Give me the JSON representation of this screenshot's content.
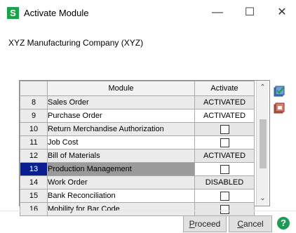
{
  "window": {
    "icon_letter": "S",
    "title": "Activate Module",
    "minimize_glyph": "—",
    "maximize_glyph": "☐",
    "close_glyph": "✕"
  },
  "company": "XYZ Manufacturing Company (XYZ)",
  "grid": {
    "columns": [
      "",
      "Module",
      "Activate"
    ],
    "rows": [
      {
        "num": "8",
        "module": "Sales Order",
        "activate": "ACTIVATED",
        "checkbox": false
      },
      {
        "num": "9",
        "module": "Purchase Order",
        "activate": "ACTIVATED",
        "checkbox": false
      },
      {
        "num": "10",
        "module": "Return Merchandise Authorization",
        "activate": "",
        "checkbox": true
      },
      {
        "num": "11",
        "module": "Job Cost",
        "activate": "",
        "checkbox": true
      },
      {
        "num": "12",
        "module": "Bill of Materials",
        "activate": "ACTIVATED",
        "checkbox": false
      },
      {
        "num": "13",
        "module": "Production Management",
        "activate": "",
        "checkbox": true,
        "selected": true
      },
      {
        "num": "14",
        "module": "Work Order",
        "activate": "DISABLED",
        "checkbox": false
      },
      {
        "num": "15",
        "module": "Bank Reconciliation",
        "activate": "",
        "checkbox": true
      },
      {
        "num": "16",
        "module": "Mobility for Bar Code",
        "activate": "",
        "checkbox": true
      }
    ]
  },
  "icons": {
    "check_all": "check-all-icon",
    "uncheck_all": "uncheck-all-icon",
    "help": "help-icon"
  },
  "buttons": {
    "proceed_first": "P",
    "proceed_rest": "roceed",
    "cancel_first": "C",
    "cancel_rest": "ancel",
    "help_glyph": "?"
  },
  "colors": {
    "brand_green": "#1aa34a",
    "selected_row": "#0a1f8f"
  }
}
